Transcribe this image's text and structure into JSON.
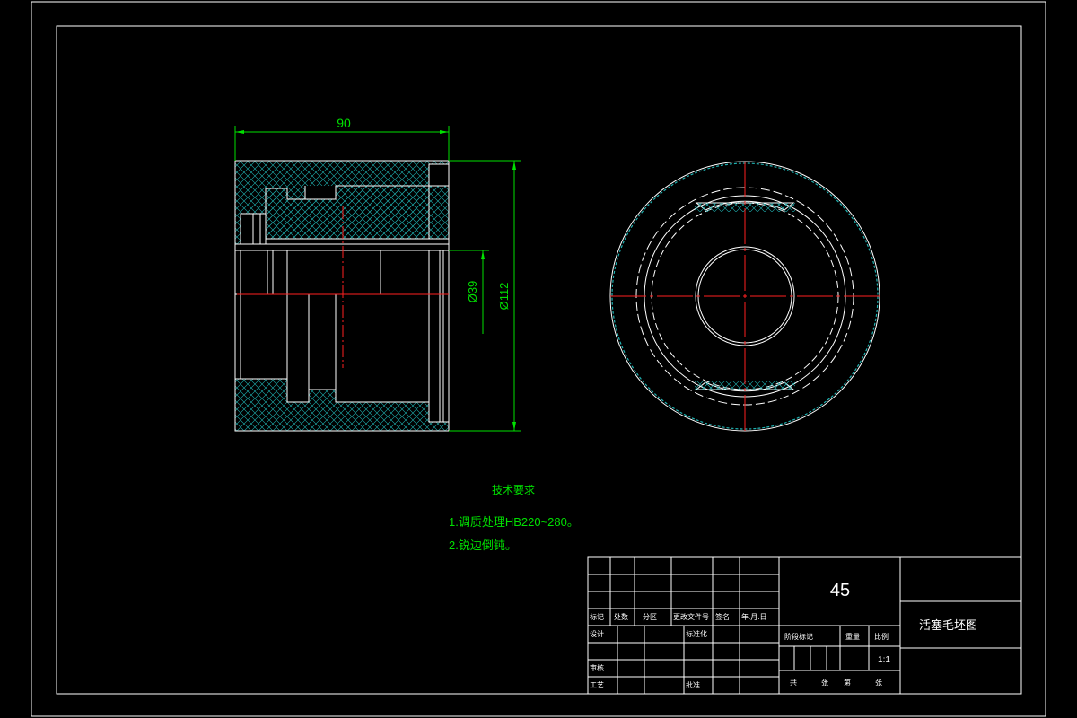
{
  "drawing": {
    "dimension_width": "90",
    "dimension_inner_dia": "Ø39",
    "dimension_outer_dia": "Ø112"
  },
  "tech_requirements": {
    "title": "技术要求",
    "item1": "1.调质处理HB220~280。",
    "item2": "2.锐边倒钝。"
  },
  "title_block": {
    "material": "45",
    "part_name": "活塞毛坯图",
    "scale": "1:1",
    "labels": {
      "mark": "标记",
      "count": "处数",
      "zone": "分区",
      "change_doc": "更改文件号",
      "signature": "签名",
      "date": "年.月.日",
      "design": "设计",
      "standardize": "标准化",
      "review": "审核",
      "process": "工艺",
      "approve": "批准",
      "stage_mark": "阶段标记",
      "weight": "重量",
      "scale_label": "比例",
      "sheets_total": "共",
      "sheet": "张",
      "sheet_no": "第"
    }
  },
  "colors": {
    "line": "#ffffff",
    "hatch": "#20b2b2",
    "dimension": "#00e000",
    "centerline": "#ff2020",
    "background": "#000000"
  }
}
